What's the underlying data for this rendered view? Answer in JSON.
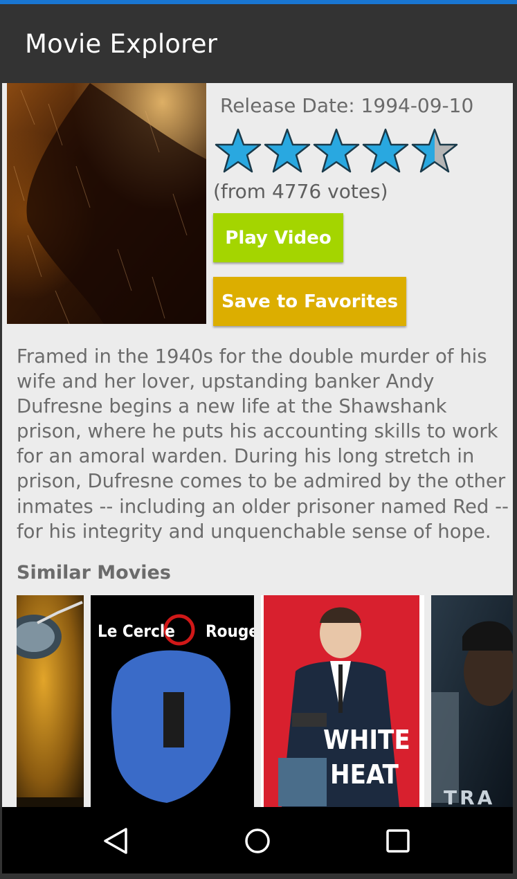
{
  "app": {
    "title": "Movie Explorer"
  },
  "movie": {
    "release_label": "Release Date: 1994-09-10",
    "rating_stars": 4.5,
    "rating_max": 5,
    "votes_text": "(from 4776 votes)",
    "overview": "Framed in the 1940s for the double murder of his wife and her lover, upstanding banker Andy Dufresne begins a new life at the Shawshank prison, where he puts his accounting skills to work for an amoral warden. During his long stretch in prison, Dufresne comes to be admired by the other inmates -- including an older prisoner named Red -- for his integrity and unquenchable sense of hope."
  },
  "actions": {
    "play_label": "Play Video",
    "save_label": "Save to Favorites"
  },
  "similar": {
    "heading": "Similar Movies",
    "items": [
      {
        "poster_text": ""
      },
      {
        "poster_text_left": "Le Cercle",
        "poster_text_right": "Rouge"
      },
      {
        "poster_text_line1": "WHITE",
        "poster_text_line2": "HEAT"
      },
      {
        "poster_text": "TRA"
      }
    ]
  },
  "colors": {
    "appbar": "#333333",
    "accent_line": "#1976d2",
    "star_fill": "#29a8e0",
    "star_empty": "#b5b5b5",
    "play_button": "#a4d500",
    "save_button": "#dcae00"
  },
  "icons": [
    "back-icon",
    "home-icon",
    "recents-icon",
    "star-icon"
  ]
}
